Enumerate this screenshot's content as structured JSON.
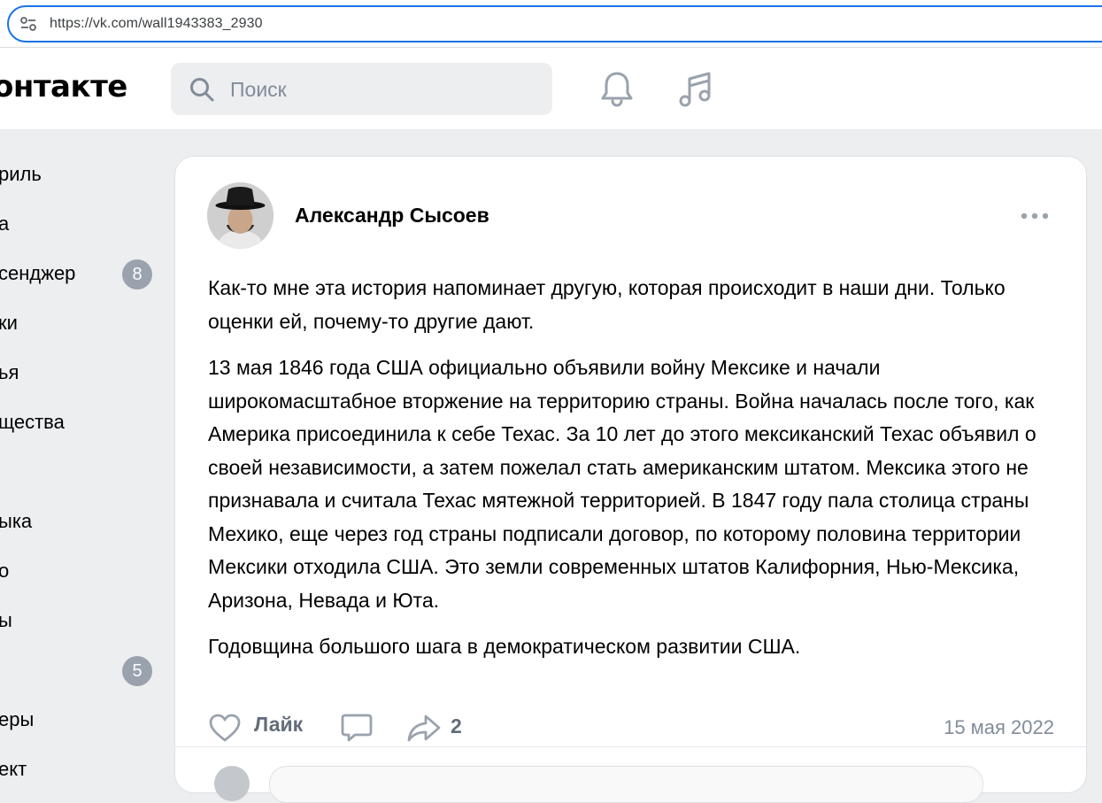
{
  "browser": {
    "url": "https://vk.com/wall1943383_2930"
  },
  "header": {
    "logo": "онтакте",
    "search_placeholder": "Поиск"
  },
  "sidebar": {
    "items": [
      {
        "label": "риль"
      },
      {
        "label": "а"
      },
      {
        "label": "сенджер",
        "badge": "8"
      },
      {
        "label": "ки"
      },
      {
        "label": "ья"
      },
      {
        "label": "щества"
      },
      {
        "label": "ыка"
      },
      {
        "label": "о"
      },
      {
        "label": "ы"
      },
      {
        "label": "",
        "badge": "5"
      },
      {
        "label": "еры"
      },
      {
        "label": "ект"
      }
    ]
  },
  "post": {
    "author": "Александр Сысоев",
    "paragraphs": [
      "Как-то мне эта история напоминает другую, которая происходит в наши дни. Только оценки ей, почему-то другие дают.",
      "13 мая 1846 года США официально объявили войну Мексике и начали широкомасштабное вторжение на территорию страны. Война началась после того, как Америка присоединила к себе Техас. За 10 лет до этого мексиканский Техас объявил о своей независимости, а затем пожелал стать американским штатом. Мексика этого не признавала и считала Техас мятежной территорией. В 1847 году пала столица страны Мехико, еще через год страны подписали договор, по которому половина территории Мексики отходила США. Это земли современных штатов Калифорния, Нью-Мексика, Аризона, Невада и Юта.",
      "Годовщина большого шага в демократическом развитии США."
    ],
    "like_label": "Лайк",
    "share_count": "2",
    "date": "15 мая 2022"
  }
}
